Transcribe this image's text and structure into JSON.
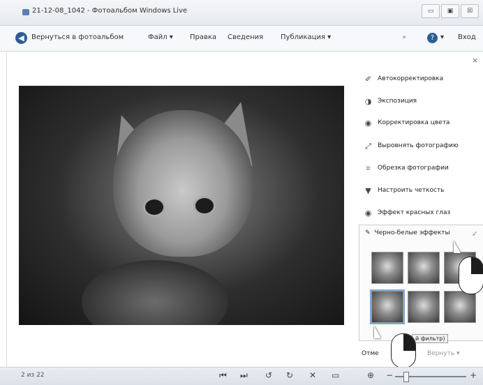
{
  "window": {
    "title": "21-12-08_1042 - Фотоальбом Windows Live",
    "buttons": [
      "▭",
      "▣",
      "☒"
    ]
  },
  "menubar": {
    "back_label": "Вернуться в фотоальбом",
    "file_label": "Файл ▾",
    "fix_label": "Правка",
    "info_label": "Сведения",
    "publish_label": "Публикация ▾",
    "more_label": "»",
    "help_label": "?",
    "help_arrow": "▾",
    "signin_label": "Вход"
  },
  "panel": {
    "close": "×",
    "tasks": [
      {
        "icon": "wand-icon",
        "glyph": "✐",
        "label": "Автокорректировка"
      },
      {
        "icon": "exposure-icon",
        "glyph": "◑",
        "label": "Экспозиция"
      },
      {
        "icon": "color-icon",
        "glyph": "◉",
        "label": "Корректировка цвета"
      },
      {
        "icon": "straighten-icon",
        "glyph": "⤢",
        "label": "Выровнять фотографию"
      },
      {
        "icon": "crop-icon",
        "glyph": "⌗",
        "label": "Обрезка фотографии"
      },
      {
        "icon": "sharpen-icon",
        "glyph": "▼",
        "label": "Настроить четкость"
      },
      {
        "icon": "redeye-icon",
        "glyph": "◉",
        "label": "Эффект красных глаз"
      }
    ],
    "bw": {
      "label": "Черно-белые эффекты",
      "icon_glyph": "✎",
      "check": "✓",
      "tooltip": "й фильтр)"
    },
    "undo_label": "Отме",
    "redo_label": "Вернуть ▾"
  },
  "statusbar": {
    "count": "2 из 22",
    "controls": {
      "first": "⏮",
      "last": "⏭",
      "rotate_left": "↺",
      "rotate_right": "↻",
      "delete": "✕",
      "slideshow": "▭",
      "fit": "⊕",
      "zoom_out": "−",
      "zoom_in": "+"
    }
  }
}
